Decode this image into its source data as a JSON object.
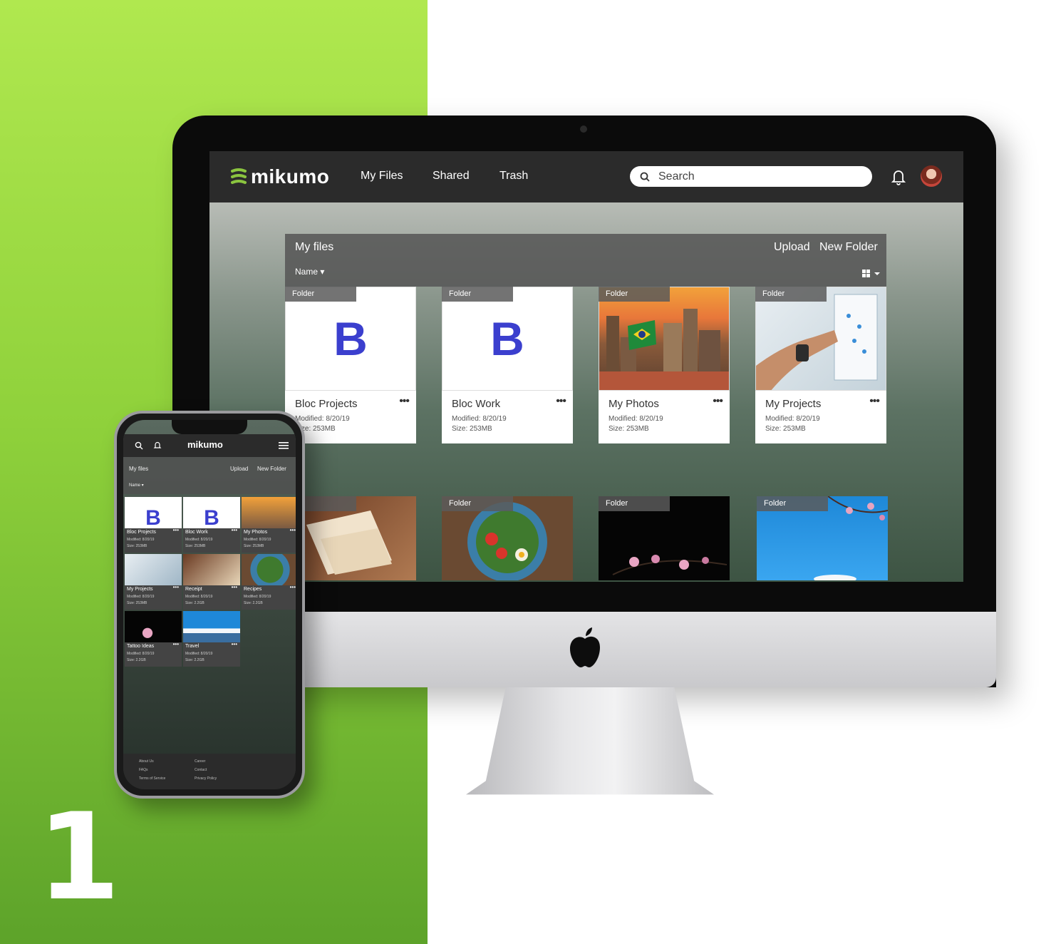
{
  "marketing": {
    "number": "1"
  },
  "app": {
    "logo": "mikumo",
    "nav": [
      "My Files",
      "Shared",
      "Trash"
    ],
    "search_placeholder": "Search"
  },
  "panel": {
    "title": "My files",
    "upload": "Upload",
    "new_folder": "New Folder",
    "sort": "Name ▾"
  },
  "folder_tag": "Folder",
  "cards": [
    {
      "name": "Bloc Projects",
      "modified": "Modified: 8/20/19",
      "size": "Size: 253MB",
      "letter": "B"
    },
    {
      "name": "Bloc Work",
      "modified": "Modified: 8/20/19",
      "size": "Size: 253MB",
      "letter": "B"
    },
    {
      "name": "My Photos",
      "modified": "Modified: 8/20/19",
      "size": "Size: 253MB"
    },
    {
      "name": "My Projects",
      "modified": "Modified: 8/20/19",
      "size": "Size: 253MB"
    }
  ],
  "row2_tags": [
    "ler",
    "Folder",
    "Folder",
    "Folder"
  ],
  "more_label": "•••",
  "phone": {
    "logo": "mikumo",
    "title": "My files",
    "upload": "Upload",
    "new_folder": "New Folder",
    "sort": "Name ▾",
    "cards": [
      {
        "name": "Bloc Projects",
        "modified": "Modified: 8/20/19",
        "size": "Size: 253MB"
      },
      {
        "name": "Bloc Work",
        "modified": "Modified: 8/20/19",
        "size": "Size: 253MB"
      },
      {
        "name": "My Photos",
        "modified": "Modified: 8/20/19",
        "size": "Size: 253MB"
      },
      {
        "name": "My Projects",
        "modified": "Modified: 8/20/19",
        "size": "Size: 253MB"
      },
      {
        "name": "Receipt",
        "modified": "Modified: 8/20/19",
        "size": "Size: 2.2GB"
      },
      {
        "name": "Recipes",
        "modified": "Modified: 8/20/19",
        "size": "Size: 2.2GB"
      },
      {
        "name": "Tattoo Ideas",
        "modified": "Modified: 8/20/19",
        "size": "Size: 2.2GB"
      },
      {
        "name": "Travel",
        "modified": "Modified: 8/20/19",
        "size": "Size: 2.2GB"
      }
    ],
    "footer": [
      "About Us",
      "FAQs",
      "Terms of Service",
      "Career",
      "Contact",
      "Privacy Policy"
    ]
  },
  "colors": {
    "brand_green": "#8bc53f",
    "accent_blue": "#3b3fce",
    "topbar": "#2b2b2b"
  }
}
